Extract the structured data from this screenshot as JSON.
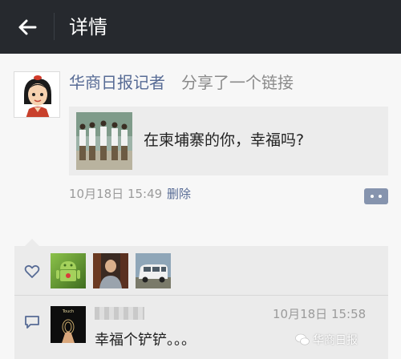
{
  "header": {
    "title": "详情",
    "back_icon": "back-arrow-icon",
    "background": "#26292e"
  },
  "post": {
    "author": "华商日报记者",
    "action": "分享了一个链接",
    "link_title": "在柬埔寨的你，幸福吗?",
    "time": "10月18日 15:49",
    "delete_label": "删除",
    "more_icon": "more-comment-icon"
  },
  "likes": {
    "icon": "heart-icon",
    "avatars": [
      "android-avatar",
      "person-avatar",
      "van-avatar"
    ]
  },
  "comment": {
    "icon": "comment-icon",
    "time": "10月18日 15:58",
    "text": "幸福个铲铲。。。"
  },
  "watermark": {
    "text": "华商日报",
    "icon": "wechat-icon"
  },
  "colors": {
    "link_blue": "#576b95",
    "panel": "#ebebeb",
    "background": "#f7f7f7"
  }
}
